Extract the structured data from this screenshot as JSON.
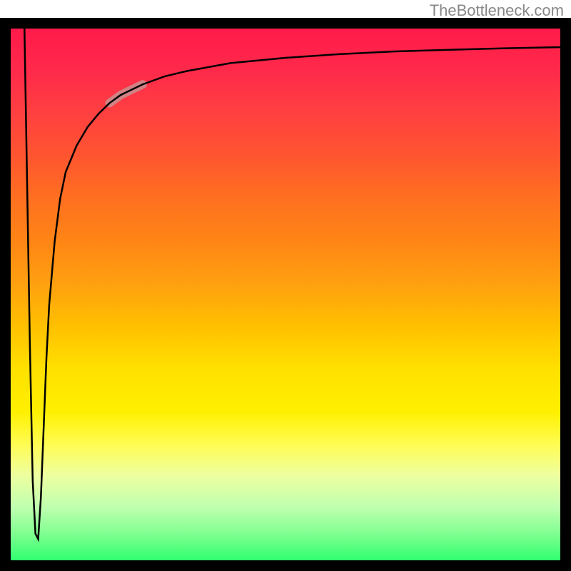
{
  "watermark": "TheBottleneck.com",
  "chart_data": {
    "type": "line",
    "title": "",
    "xlabel": "",
    "ylabel": "",
    "xlim": [
      0,
      100
    ],
    "ylim": [
      0,
      100
    ],
    "series": [
      {
        "name": "bottleneck-curve",
        "x": [
          2.5,
          3,
          3.5,
          4,
          4.5,
          5,
          5.5,
          6,
          6.5,
          7,
          8,
          9,
          10,
          12,
          14,
          16,
          18,
          20,
          24,
          28,
          32,
          40,
          50,
          60,
          70,
          80,
          90,
          100
        ],
        "y": [
          100,
          70,
          40,
          15,
          5,
          4,
          12,
          25,
          38,
          48,
          60,
          68,
          73,
          78,
          81.5,
          84,
          86,
          87.5,
          89.5,
          91,
          92,
          93.5,
          94.5,
          95.2,
          95.7,
          96,
          96.3,
          96.5
        ]
      }
    ],
    "highlight_segment": {
      "x_range": [
        18,
        24
      ],
      "color": "#c89090",
      "note": "thicker pale segment on curve"
    },
    "background_gradient": {
      "top": "#ff1a4a",
      "middle": "#fff000",
      "bottom": "#30ff70"
    }
  }
}
